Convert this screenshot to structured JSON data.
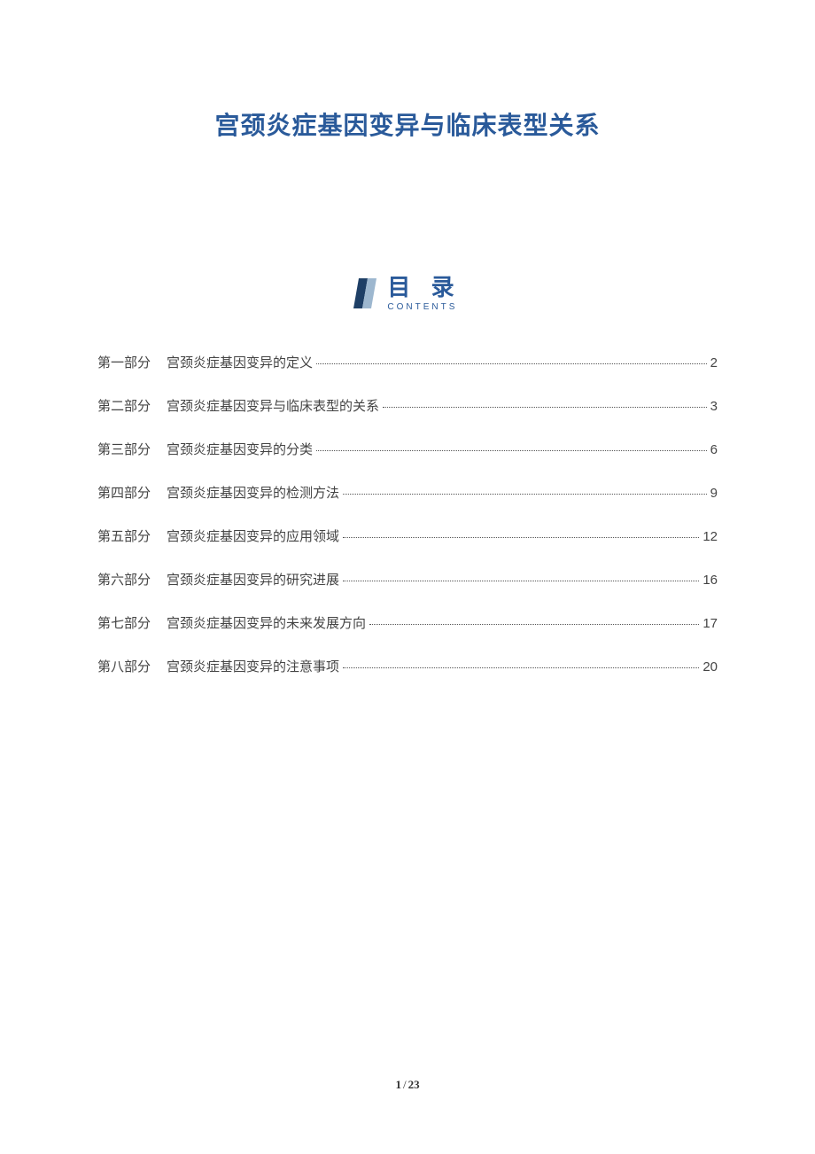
{
  "title": "宫颈炎症基因变异与临床表型关系",
  "toc_header": {
    "cn": "目 录",
    "en": "CONTENTS"
  },
  "toc": [
    {
      "part": "第一部分",
      "name": "宫颈炎症基因变异的定义",
      "page": "2"
    },
    {
      "part": "第二部分",
      "name": "宫颈炎症基因变异与临床表型的关系",
      "page": "3"
    },
    {
      "part": "第三部分",
      "name": "宫颈炎症基因变异的分类",
      "page": "6"
    },
    {
      "part": "第四部分",
      "name": "宫颈炎症基因变异的检测方法",
      "page": "9"
    },
    {
      "part": "第五部分",
      "name": "宫颈炎症基因变异的应用领域",
      "page": "12"
    },
    {
      "part": "第六部分",
      "name": "宫颈炎症基因变异的研究进展",
      "page": "16"
    },
    {
      "part": "第七部分",
      "name": "宫颈炎症基因变异的未来发展方向",
      "page": "17"
    },
    {
      "part": "第八部分",
      "name": "宫颈炎症基因变异的注意事项",
      "page": "20"
    }
  ],
  "footer": {
    "current": "1",
    "separator": "/",
    "total": "23"
  }
}
